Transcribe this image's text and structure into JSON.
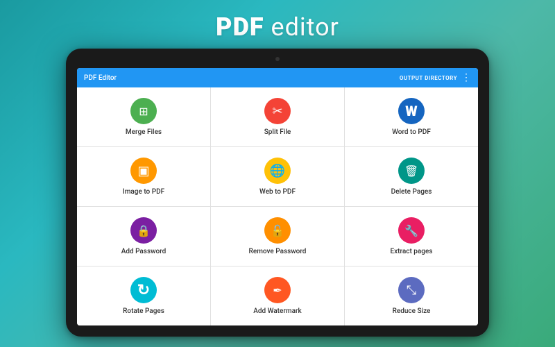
{
  "header": {
    "title_bold": "PDF",
    "title_normal": " editor"
  },
  "topbar": {
    "title": "PDF Editor",
    "action": "OUTPUT DIRECTORY",
    "dots": "⋮"
  },
  "grid": {
    "items": [
      {
        "id": "merge-files",
        "label": "Merge Files",
        "icon": "📄",
        "color": "green",
        "symbol": "⊞"
      },
      {
        "id": "split-file",
        "label": "Split File",
        "icon": "✂",
        "color": "red",
        "symbol": "✂"
      },
      {
        "id": "word-to-pdf",
        "label": "Word to PDF",
        "icon": "W",
        "color": "blue-dark",
        "symbol": "W"
      },
      {
        "id": "image-to-pdf",
        "label": "Image to PDF",
        "icon": "🖼",
        "color": "orange",
        "symbol": "🖼"
      },
      {
        "id": "web-to-pdf",
        "label": "Web to PDF",
        "icon": "🌐",
        "color": "yellow",
        "symbol": "🌐"
      },
      {
        "id": "delete-pages",
        "label": "Delete Pages",
        "icon": "🗑",
        "color": "teal",
        "symbol": "🗑"
      },
      {
        "id": "add-password",
        "label": "Add Password",
        "icon": "🔒",
        "color": "purple",
        "symbol": "🔒"
      },
      {
        "id": "remove-password",
        "label": "Remove Password",
        "icon": "🔓",
        "color": "amber",
        "symbol": "🔓"
      },
      {
        "id": "extract-pages",
        "label": "Extract pages",
        "icon": "🔗",
        "color": "pink",
        "symbol": "🔧"
      },
      {
        "id": "rotate-pages",
        "label": "Rotate Pages",
        "icon": "↻",
        "color": "cyan",
        "symbol": "↻"
      },
      {
        "id": "add-watermark",
        "label": "Add Watermark",
        "icon": "✒",
        "color": "deep-orange",
        "symbol": "✒"
      },
      {
        "id": "reduce-size",
        "label": "Reduce Size",
        "icon": "⤡",
        "color": "indigo",
        "symbol": "⤡"
      }
    ]
  }
}
